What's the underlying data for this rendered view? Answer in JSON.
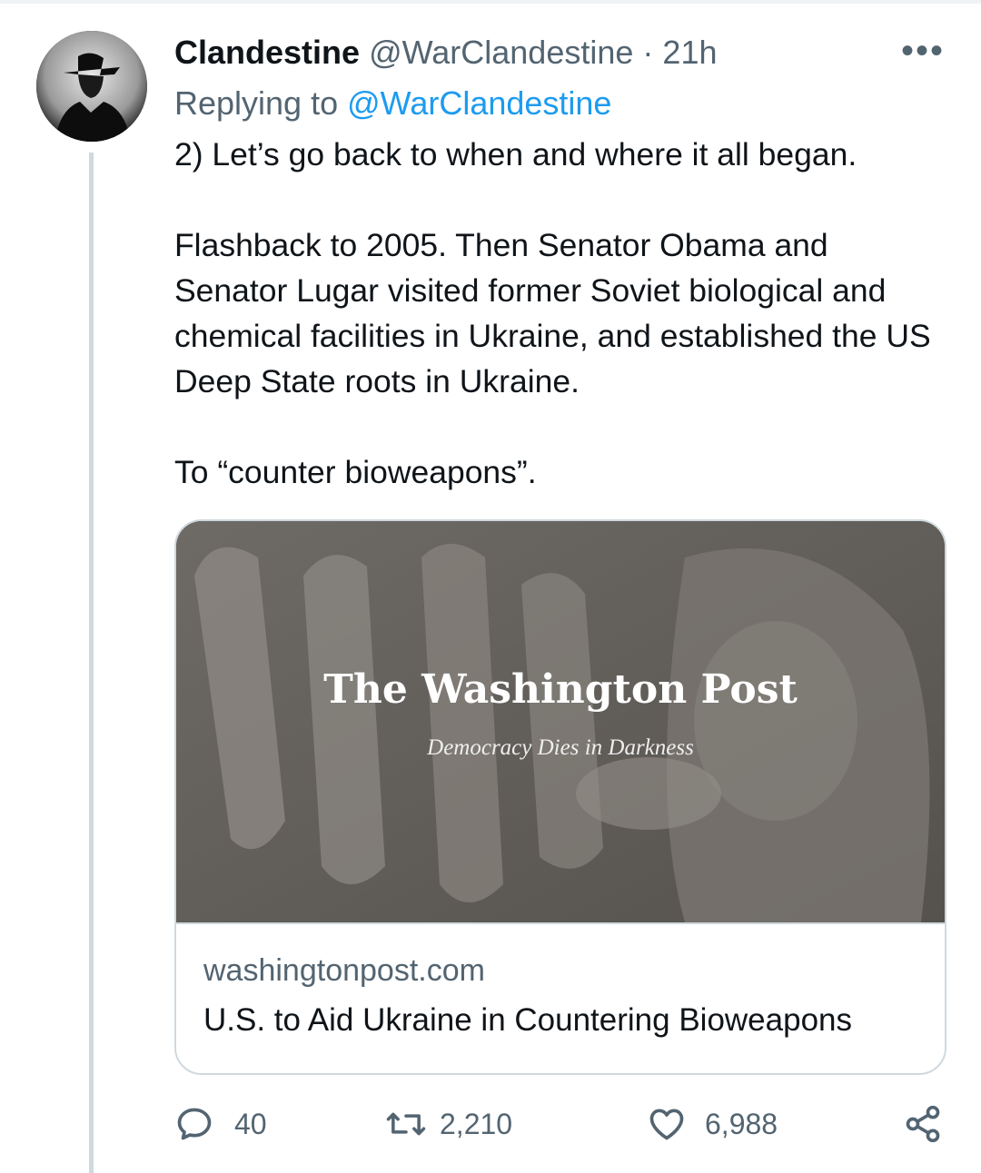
{
  "tweet": {
    "display_name": "Clandestine",
    "handle": "@WarClandestine",
    "separator": "·",
    "time": "21h",
    "more_label": "•••",
    "replying_prefix": "Replying to",
    "replying_to": "@WarClandestine",
    "text_paragraphs": [
      "2) Let’s go back to when and where it all began.",
      "Flashback to 2005. Then Senator Obama and Senator Lugar visited former Soviet biological and chemical facilities in Ukraine, and established the US Deep State roots in Ukraine.",
      "To “counter bioweapons”."
    ]
  },
  "card": {
    "logo_text": "The Washington Post",
    "tagline": "Democracy Dies in Darkness",
    "domain": "washingtonpost.com",
    "title": "U.S. to Aid Ukraine in Countering Bioweapons"
  },
  "actions": {
    "replies": "40",
    "retweets": "2,210",
    "likes": "6,988"
  },
  "icons": {
    "reply": "reply-icon",
    "retweet": "retweet-icon",
    "like": "heart-icon",
    "share": "share-icon",
    "more": "more-icon"
  },
  "colors": {
    "link": "#1d9bf0",
    "muted": "#536471",
    "text": "#0f1419",
    "border": "#cfd9de"
  }
}
